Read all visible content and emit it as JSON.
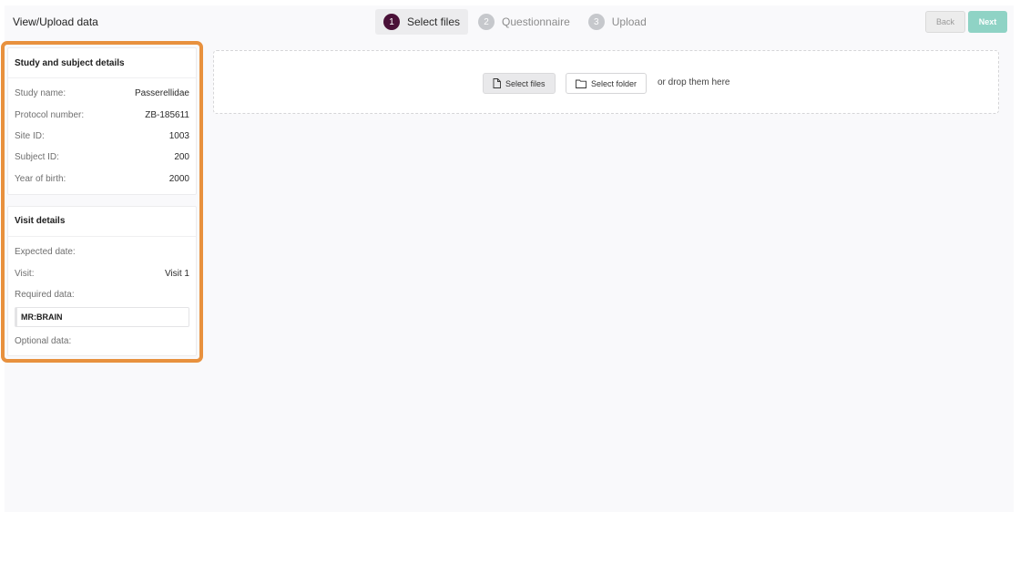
{
  "header": {
    "title": "View/Upload data",
    "steps": [
      {
        "number": "1",
        "label": "Select files",
        "active": true
      },
      {
        "number": "2",
        "label": "Questionnaire",
        "active": false
      },
      {
        "number": "3",
        "label": "Upload",
        "active": false
      }
    ],
    "back_label": "Back",
    "next_label": "Next"
  },
  "study_card": {
    "title": "Study and subject details",
    "rows": [
      {
        "label": "Study name:",
        "value": "Passerellidae"
      },
      {
        "label": "Protocol number:",
        "value": "ZB-185611"
      },
      {
        "label": "Site ID:",
        "value": "1003"
      },
      {
        "label": "Subject ID:",
        "value": "200"
      },
      {
        "label": "Year of birth:",
        "value": "2000"
      }
    ]
  },
  "visit_card": {
    "title": "Visit details",
    "expected_date_label": "Expected date:",
    "visit_label": "Visit:",
    "visit_value": "Visit 1",
    "required_label": "Required data:",
    "required_tag": "MR:BRAIN",
    "optional_label": "Optional data:"
  },
  "dropzone": {
    "select_files_label": "Select files",
    "select_folder_label": "Select folder",
    "drop_text": "or drop them here"
  },
  "colors": {
    "highlight": "#e8913e",
    "active_step": "#4a1138",
    "next_button": "#8fd3c5"
  }
}
